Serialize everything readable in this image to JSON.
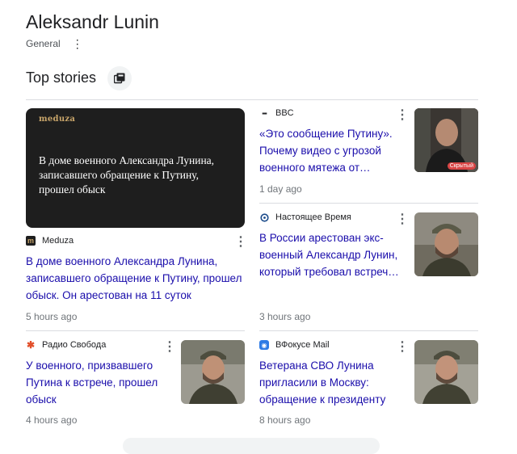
{
  "header": {
    "title": "Aleksandr Lunin",
    "subtitle": "General"
  },
  "section": {
    "title": "Top stories"
  },
  "stories": {
    "hero": {
      "image_logo": "meduza",
      "image_text": "В доме военного Александра Лунина, записавшего обращение к Путину, прошел обыск",
      "source": "Meduza",
      "headline": "В доме военного Александра Лунина, записавшего обращение к Путину, прошел обыск. Он арестован на 11 суток",
      "time": "5 hours ago"
    },
    "bbc": {
      "source": "BBC",
      "headline": "«Это сообщение Путину». Почему видео с угрозой военного мятежа от…",
      "time": "1 day ago",
      "thumb_badge": "Скрытый"
    },
    "nv": {
      "source": "Настоящее Время",
      "headline": "В России арестован экс-военный Александр Лунин, который требовал встреч…",
      "time": "3 hours ago"
    },
    "svoboda": {
      "source": "Радио Свобода",
      "headline": "У военного, призвавшего Путина к встрече, прошел обыск",
      "time": "4 hours ago"
    },
    "vfokuse": {
      "source": "ВФокусе Mail",
      "headline": "Ветерана СВО Лунина пригласили в Москву: обращение к президенту",
      "time": "8 hours ago"
    }
  },
  "colors": {
    "link": "#1a0dab",
    "meta": "#70757a",
    "divider": "#dadce0",
    "hero_bg": "#1e1e1e"
  }
}
